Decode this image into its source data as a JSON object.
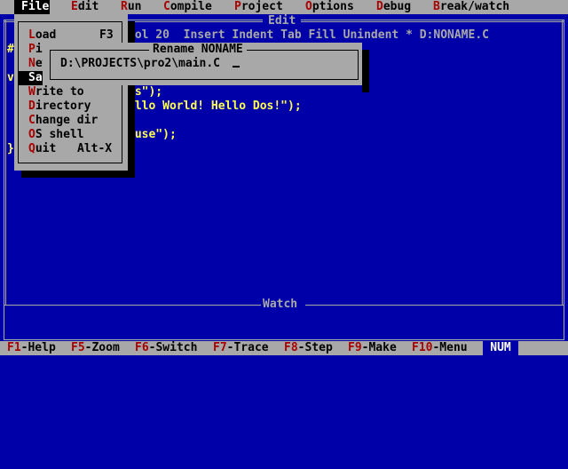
{
  "menubar": {
    "items": [
      {
        "hotkey": "F",
        "rest": "ile",
        "active": true
      },
      {
        "hotkey": "E",
        "rest": "dit"
      },
      {
        "hotkey": "R",
        "rest": "un"
      },
      {
        "hotkey": "C",
        "rest": "ompile"
      },
      {
        "hotkey": "P",
        "rest": "roject"
      },
      {
        "hotkey": "O",
        "rest": "ptions"
      },
      {
        "hotkey": "D",
        "rest": "ebug"
      },
      {
        "hotkey": "B",
        "rest": "reak/watch"
      }
    ]
  },
  "edit_window": {
    "title": "Edit",
    "status": "Col 20  Insert Indent Tab Fill Unindent * D:NONAME.C",
    "code_lines": [
      {
        "visible": "#"
      },
      {
        "visible": ""
      },
      {
        "visible": "v"
      },
      {
        "visible": "ls\");"
      },
      {
        "visible": "ello World! Hello Dos!\");"
      },
      {
        "visible": ""
      },
      {
        "visible": "ause\");"
      },
      {
        "visible": "}"
      }
    ]
  },
  "watch_window": {
    "title": "Watch"
  },
  "file_menu": {
    "items": [
      {
        "hotkey": "L",
        "rest": "oad",
        "shortcut": "F3"
      },
      {
        "hotkey": "P",
        "rest": "ic"
      },
      {
        "hotkey": "N",
        "rest": "ew"
      },
      {
        "hotkey": "S",
        "rest": "av",
        "selected": true
      },
      {
        "hotkey": "W",
        "rest": "rite to"
      },
      {
        "hotkey": "D",
        "rest": "irectory"
      },
      {
        "hotkey": "C",
        "rest": "hange dir"
      },
      {
        "hotkey": "O",
        "rest": "S shell"
      },
      {
        "hotkey": "Q",
        "rest": "uit",
        "shortcut": "Alt-X"
      }
    ]
  },
  "rename_dialog": {
    "title": "Rename NONAME",
    "value": "D:\\PROJECTS\\pro2\\main.C"
  },
  "bottombar": {
    "keys": [
      {
        "key": "F1",
        "label": "-Help"
      },
      {
        "key": "F5",
        "label": "-Zoom"
      },
      {
        "key": "F6",
        "label": "-Switch"
      },
      {
        "key": "F7",
        "label": "-Trace"
      },
      {
        "key": "F8",
        "label": "-Step"
      },
      {
        "key": "F9",
        "label": "-Make"
      },
      {
        "key": "F10",
        "label": "-Menu"
      }
    ],
    "num": "NUM"
  },
  "colors": {
    "background": "#0000a8",
    "menu_gray": "#a8a8a8",
    "hotkey_red": "#a80000",
    "code_yellow": "#ffff54"
  }
}
